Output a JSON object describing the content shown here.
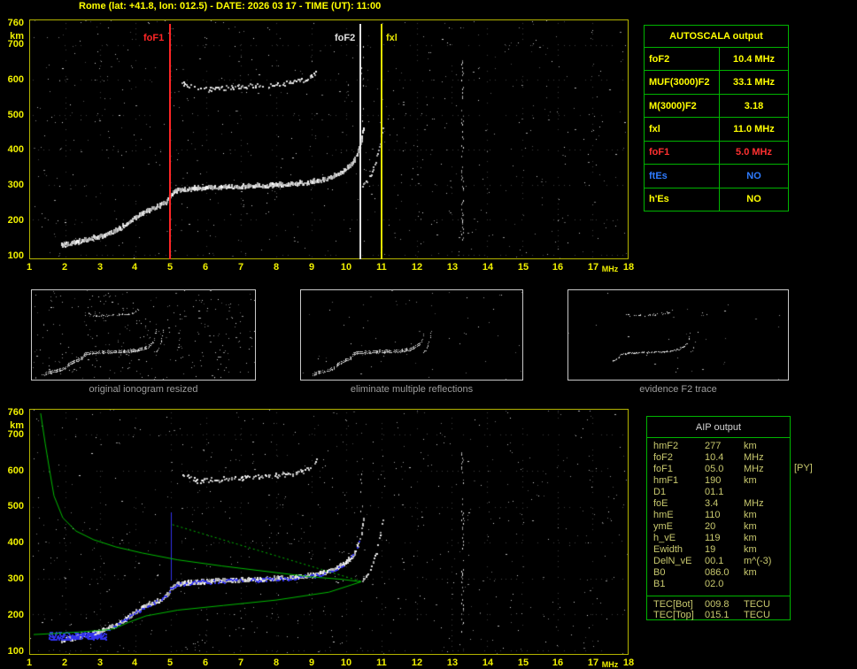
{
  "title": "Rome (lat: +41.8, lon: 012.5) - DATE: 2026 03 17 - TIME (UT): 11:00",
  "autoscala": {
    "title": "AUTOSCALA output",
    "rows": [
      {
        "label": "foF2",
        "value": "10.4 MHz",
        "color": "#ffff00"
      },
      {
        "label": "MUF(3000)F2",
        "value": "33.1 MHz",
        "color": "#ffff00"
      },
      {
        "label": "M(3000)F2",
        "value": "3.18",
        "color": "#ffff00"
      },
      {
        "label": "fxl",
        "value": "11.0 MHz",
        "color": "#ffff00"
      },
      {
        "label": "foF1",
        "value": "5.0 MHz",
        "color": "#ff3030"
      },
      {
        "label": "ftEs",
        "value": "NO",
        "color": "#2e7bff"
      },
      {
        "label": "h'Es",
        "value": "NO",
        "color": "#ffff00"
      }
    ]
  },
  "thumbnails": [
    {
      "caption": "original ionogram resized"
    },
    {
      "caption": "eliminate multiple reflections"
    },
    {
      "caption": "evidence F2 trace"
    }
  ],
  "aip": {
    "title": "AIP output",
    "rows": [
      {
        "name": "hmF2",
        "value": "277",
        "unit": "km"
      },
      {
        "name": "foF2",
        "value": "10.4",
        "unit": "MHz"
      },
      {
        "name": "foF1",
        "value": "05.0",
        "unit": "MHz"
      },
      {
        "name": "hmF1",
        "value": "190",
        "unit": "km"
      },
      {
        "name": "D1",
        "value": "01.1",
        "unit": ""
      },
      {
        "name": "foE",
        "value": "3.4",
        "unit": "MHz"
      },
      {
        "name": "hmE",
        "value": "110",
        "unit": "km"
      },
      {
        "name": "ymE",
        "value": "20",
        "unit": "km"
      },
      {
        "name": "h_vE",
        "value": "119",
        "unit": "km"
      },
      {
        "name": "Ewidth",
        "value": "19",
        "unit": "km"
      },
      {
        "name": "DelN_vE",
        "value": "00.1",
        "unit": "m^(-3)"
      },
      {
        "name": "B0",
        "value": "086.0",
        "unit": "km"
      },
      {
        "name": "B1",
        "value": "02.0",
        "unit": ""
      }
    ],
    "tec_rows": [
      {
        "name": "TEC[Bot]",
        "value": "009.8",
        "unit": "TECU"
      },
      {
        "name": "TEC[Top]",
        "value": "015.1",
        "unit": "TECU"
      }
    ],
    "side_note": "[PY]"
  },
  "ionogram": {
    "x_range": [
      1,
      18
    ],
    "y_range": [
      90,
      770
    ],
    "x_ticks": [
      1,
      2,
      3,
      4,
      5,
      6,
      7,
      8,
      9,
      10,
      11,
      12,
      13,
      14,
      15,
      16,
      17,
      18
    ],
    "x_unit": "MHz",
    "y_ticks": [
      760,
      700,
      600,
      500,
      400,
      300,
      200,
      100
    ],
    "y_unit": "km",
    "markers": [
      {
        "label": "foF1",
        "mhz": 5.0,
        "color": "#ff2626",
        "label_dx": -30
      },
      {
        "label": "foF2",
        "mhz": 10.4,
        "color": "#e0e0e0",
        "label_dx": -29
      },
      {
        "label": "fxl",
        "mhz": 11.0,
        "color": "#e2e200",
        "label_dx": 5
      }
    ],
    "traces": {
      "ordinary": [
        [
          1.9,
          126
        ],
        [
          2.2,
          132
        ],
        [
          2.6,
          142
        ],
        [
          3.0,
          152
        ],
        [
          3.45,
          168
        ],
        [
          3.7,
          185
        ],
        [
          3.95,
          203
        ],
        [
          4.2,
          218
        ],
        [
          4.45,
          230
        ],
        [
          4.7,
          240
        ],
        [
          4.9,
          252
        ],
        [
          5.0,
          272
        ],
        [
          5.2,
          283
        ],
        [
          5.7,
          289
        ],
        [
          6.7,
          294
        ],
        [
          7.7,
          297
        ],
        [
          8.5,
          302
        ],
        [
          9.0,
          307
        ],
        [
          9.35,
          314
        ],
        [
          9.7,
          326
        ],
        [
          9.97,
          342
        ],
        [
          10.15,
          359
        ],
        [
          10.27,
          379
        ],
        [
          10.37,
          404
        ],
        [
          10.43,
          431
        ],
        [
          10.48,
          459
        ]
      ],
      "xmode": [
        [
          10.45,
          296
        ],
        [
          10.6,
          312
        ],
        [
          10.72,
          334
        ],
        [
          10.85,
          374
        ],
        [
          10.93,
          410
        ],
        [
          10.99,
          441
        ],
        [
          11.03,
          463
        ]
      ],
      "second_hop": [
        [
          5.3,
          593
        ],
        [
          5.5,
          585
        ],
        [
          5.75,
          573
        ],
        [
          6.2,
          575
        ],
        [
          6.7,
          579
        ],
        [
          7.2,
          582
        ],
        [
          7.7,
          585
        ],
        [
          8.2,
          589
        ],
        [
          8.6,
          595
        ],
        [
          8.9,
          604
        ],
        [
          9.05,
          615
        ],
        [
          9.15,
          629
        ]
      ]
    },
    "profile": {
      "color": "#00bc00",
      "topside": [
        [
          1.3,
          760
        ],
        [
          1.43,
          676
        ],
        [
          1.55,
          604
        ],
        [
          1.68,
          530
        ],
        [
          1.93,
          469
        ],
        [
          2.31,
          432
        ],
        [
          2.81,
          408
        ],
        [
          3.44,
          388
        ],
        [
          4.19,
          371
        ],
        [
          5.2,
          352
        ],
        [
          6.45,
          335
        ],
        [
          7.7,
          320
        ],
        [
          8.96,
          305
        ],
        [
          9.84,
          298
        ],
        [
          10.42,
          291
        ]
      ],
      "bottomside": [
        [
          10.42,
          291
        ],
        [
          9.5,
          262
        ],
        [
          8.0,
          240
        ],
        [
          6.5,
          225
        ],
        [
          5.2,
          212
        ],
        [
          4.3,
          196
        ],
        [
          3.8,
          178
        ],
        [
          3.5,
          165
        ],
        [
          3.3,
          158
        ],
        [
          2.4,
          151
        ],
        [
          1.5,
          146
        ],
        [
          1.1,
          144
        ]
      ],
      "valley_line": [
        [
          5.05,
          450
        ],
        [
          10.42,
          292
        ]
      ]
    },
    "restored": {
      "color": "#3232ee",
      "spike_f": 5.02,
      "spike_top": 487,
      "blob": [
        1.55,
        3.15,
        130,
        150
      ]
    }
  }
}
